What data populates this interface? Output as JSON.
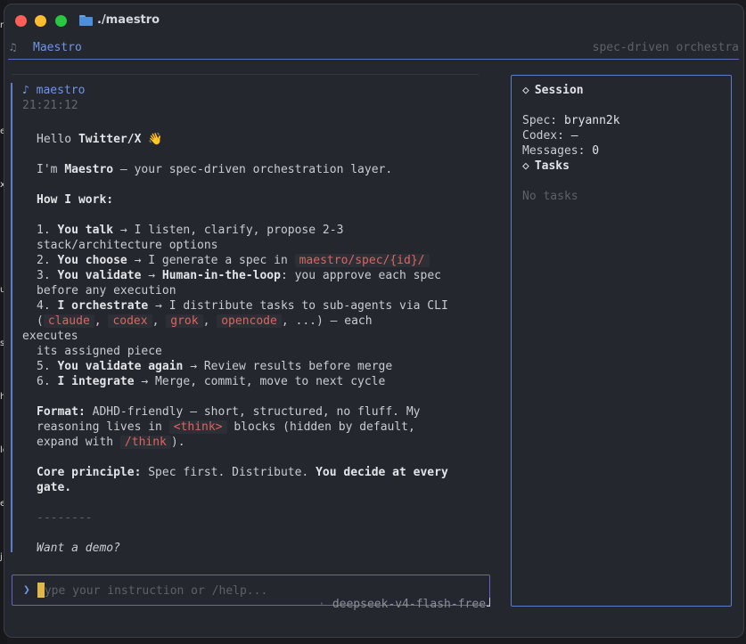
{
  "desktop_edge": [
    "n",
    "er",
    "x",
    "u",
    "s",
    "h",
    "lo",
    "e",
    "j"
  ],
  "window": {
    "title": "./maestro",
    "folder_icon": "folder-icon"
  },
  "header": {
    "app_name": "Maestro",
    "tagline": "spec-driven orchestra"
  },
  "message": {
    "author": "♪ maestro",
    "time": "21:21:12",
    "greeting_pre": "Hello ",
    "greeting_bold": "Twitter/X",
    "greeting_emoji": " 👋",
    "intro_pre": "I'm ",
    "intro_bold": "Maestro",
    "intro_post": " — your spec-driven orchestration layer.",
    "how_title": "How I work:",
    "s1_num": "1. ",
    "s1_bold": "You talk",
    "s1_text": " → I listen, clarify, propose 2-3",
    "s1_cont": "stack/architecture options",
    "s2_num": "2. ",
    "s2_bold": "You choose",
    "s2_text": " → I generate a spec in ",
    "s2_code": "maestro/spec/{id}/",
    "s3_num": "3. ",
    "s3_bold": "You validate",
    "s3_arrow": " → ",
    "s3_bold2": "Human-in-the-loop",
    "s3_text": ": you approve each spec",
    "s3_cont": "before any execution",
    "s4_num": "4. ",
    "s4_bold": "I orchestrate",
    "s4_text": " → I distribute tasks to sub-agents via CLI",
    "s4_open": "(",
    "s4_code1": "claude",
    "s4_sep1": ", ",
    "s4_code2": "codex",
    "s4_sep2": ", ",
    "s4_code3": "grok",
    "s4_sep3": ", ",
    "s4_code4": "opencode",
    "s4_close": ", ...) — each",
    "s4_wrap": "executes",
    "s4_cont": "its assigned piece",
    "s5_num": "5. ",
    "s5_bold": "You validate again",
    "s5_text": " → Review results before merge",
    "s6_num": "6. ",
    "s6_bold": "I integrate",
    "s6_text": " → Merge, commit, move to next cycle",
    "format_bold": "Format:",
    "format_text": " ADHD-friendly — short, structured, no fluff. My",
    "format_l2_pre": "reasoning lives in ",
    "format_code1": "<think>",
    "format_l2_post": " blocks (hidden by default,",
    "format_l3_pre": "expand with ",
    "format_code2": "/think",
    "format_l3_post": ").",
    "core_bold": "Core principle:",
    "core_text": " Spec first. Distribute. ",
    "core_bold2": "You decide at every",
    "core_bold3": "gate.",
    "divider": "--------",
    "closing": "Want a demo?"
  },
  "input": {
    "prompt_symbol": "❯",
    "placeholder": "Type your instruction or /help..."
  },
  "model": {
    "dot": "·",
    "name": "deepseek-v4-flash-free"
  },
  "session": {
    "title": "Session",
    "spec_label": "Spec:",
    "spec_value": "bryann2k",
    "codex_label": "Codex:",
    "codex_value": "—",
    "messages_label": "Messages:",
    "messages_value": "0",
    "tasks_title": "Tasks",
    "tasks_empty": "No tasks"
  },
  "colors": {
    "accent": "#6f96e6",
    "code": "#e0635f",
    "input_border": "#6b5fcf",
    "cursor": "#e2b64d"
  }
}
